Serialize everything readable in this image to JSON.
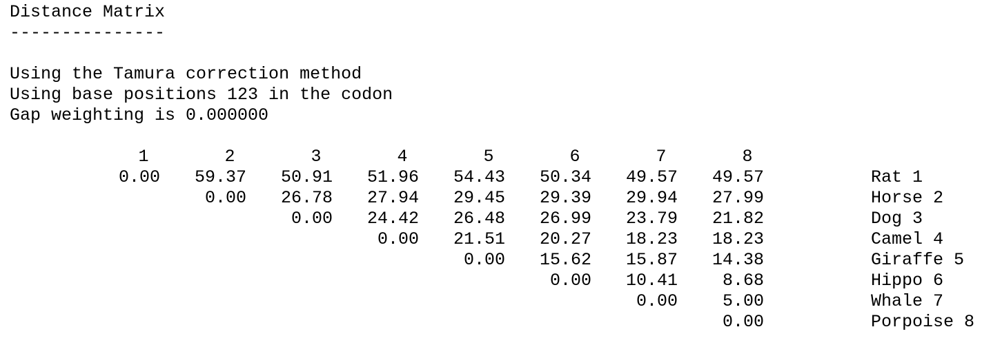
{
  "heading": "Distance Matrix",
  "underline": "---------------",
  "info": [
    "Using the Tamura correction method",
    "Using base positions 123 in the codon",
    "Gap weighting is 0.000000"
  ],
  "matrix": {
    "column_headers": [
      "1",
      "2",
      "3",
      "4",
      "5",
      "6",
      "7",
      "8"
    ],
    "rows": [
      {
        "label": "Rat 1",
        "cells": [
          "0.00",
          "59.37",
          "50.91",
          "51.96",
          "54.43",
          "50.34",
          "49.57",
          "49.57"
        ]
      },
      {
        "label": "Horse 2",
        "cells": [
          "",
          "0.00",
          "26.78",
          "27.94",
          "29.45",
          "29.39",
          "29.94",
          "27.99"
        ]
      },
      {
        "label": "Dog 3",
        "cells": [
          "",
          "",
          "0.00",
          "24.42",
          "26.48",
          "26.99",
          "23.79",
          "21.82"
        ]
      },
      {
        "label": "Camel 4",
        "cells": [
          "",
          "",
          "",
          "0.00",
          "21.51",
          "20.27",
          "18.23",
          "18.23"
        ]
      },
      {
        "label": "Giraffe 5",
        "cells": [
          "",
          "",
          "",
          "",
          "0.00",
          "15.62",
          "15.87",
          "14.38"
        ]
      },
      {
        "label": "Hippo 6",
        "cells": [
          "",
          "",
          "",
          "",
          "",
          "0.00",
          "10.41",
          "8.68"
        ]
      },
      {
        "label": "Whale 7",
        "cells": [
          "",
          "",
          "",
          "",
          "",
          "",
          "0.00",
          "5.00"
        ]
      },
      {
        "label": "Porpoise 8",
        "cells": [
          "",
          "",
          "",
          "",
          "",
          "",
          "",
          "0.00"
        ]
      }
    ]
  }
}
